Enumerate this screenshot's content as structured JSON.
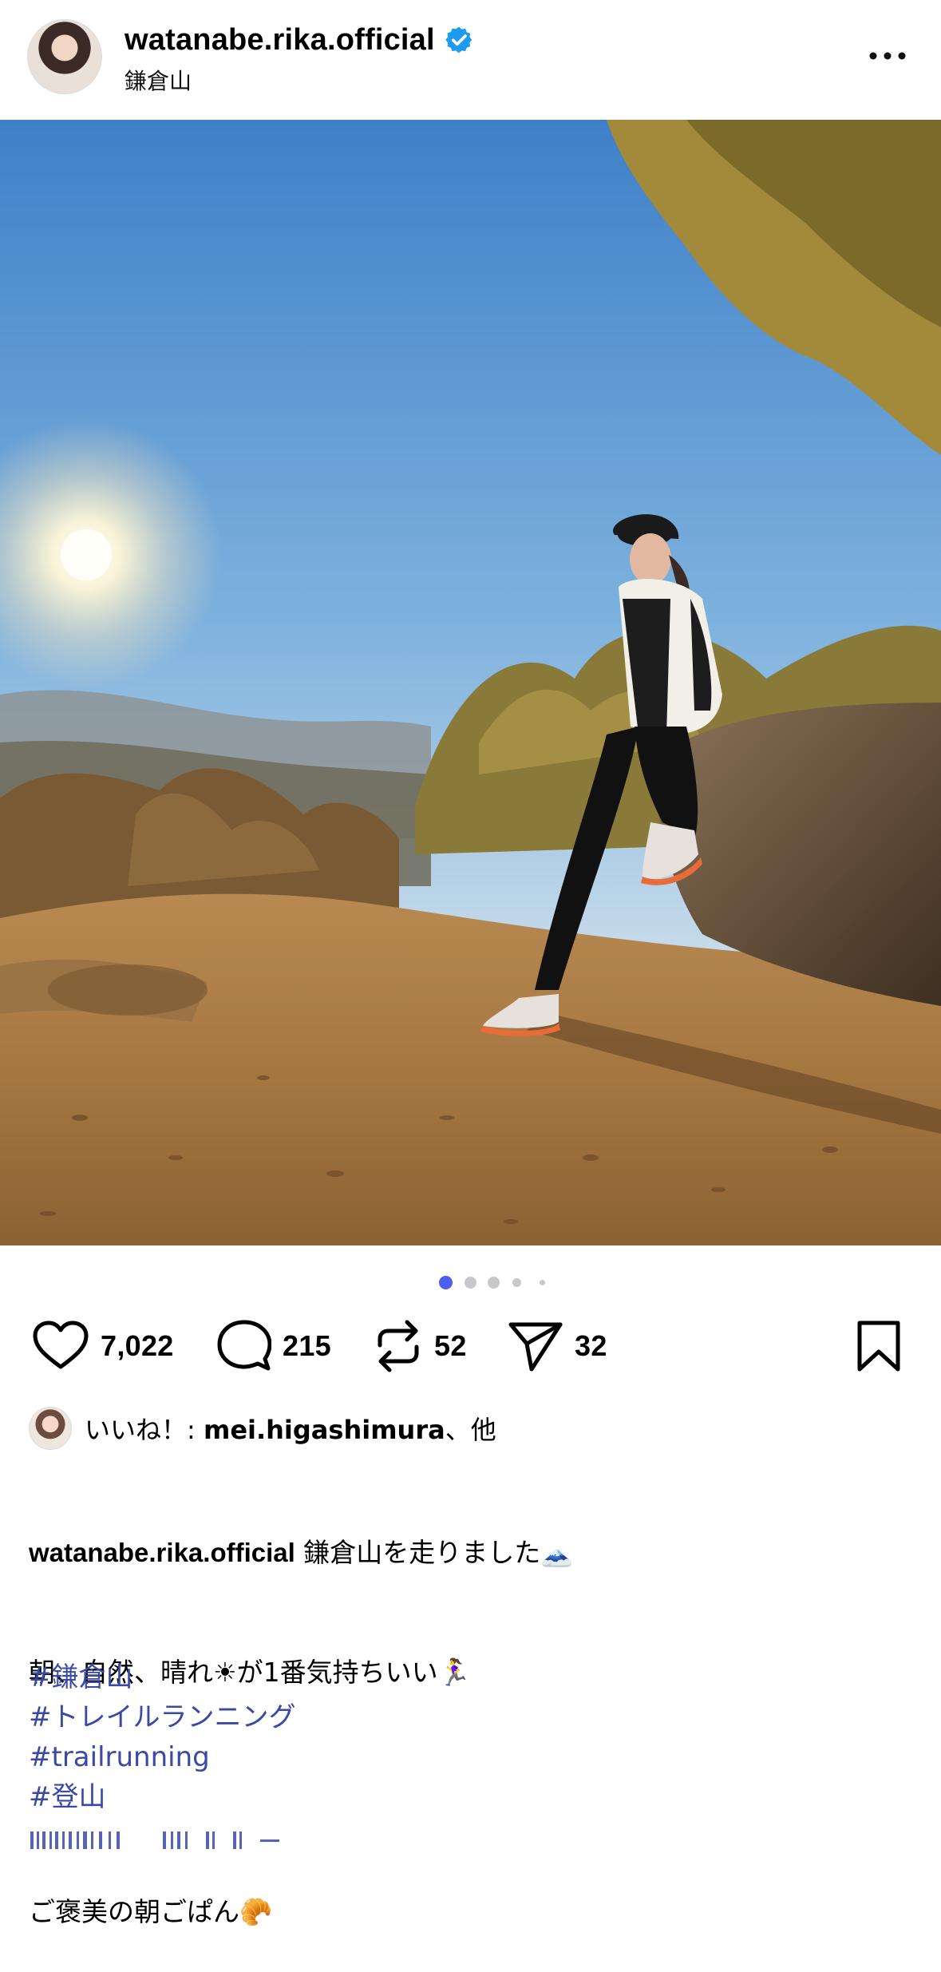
{
  "header": {
    "username": "watanabe.rika.official",
    "location": "鎌倉山",
    "verified_icon": "verified-badge-icon",
    "more_icon": "more-horizontal-icon"
  },
  "carousel": {
    "total": 5,
    "active_index": 0
  },
  "actions": {
    "likes": "7,022",
    "comments": "215",
    "reposts": "52",
    "shares": "32"
  },
  "likes_line": {
    "prefix": "いいね！: ",
    "user": "mei.higashimura",
    "suffix": "、他"
  },
  "caption": {
    "user": "watanabe.rika.official",
    "line1": " 鎌倉山を走りました🗻",
    "line2": "朝、自然、晴れ☀が1番気持ちいい🏃‍♀️",
    "line3": "",
    "line4": "ご褒美の朝ごぱん🥐"
  },
  "hashtags": [
    "#鎌倉山",
    "#トレイルランニング",
    "#trailrunning",
    "#登山"
  ],
  "colors": {
    "accent_blue": "#4b5ff0",
    "hashtag": "#3b49a6",
    "verified": "#1d9bf0"
  }
}
